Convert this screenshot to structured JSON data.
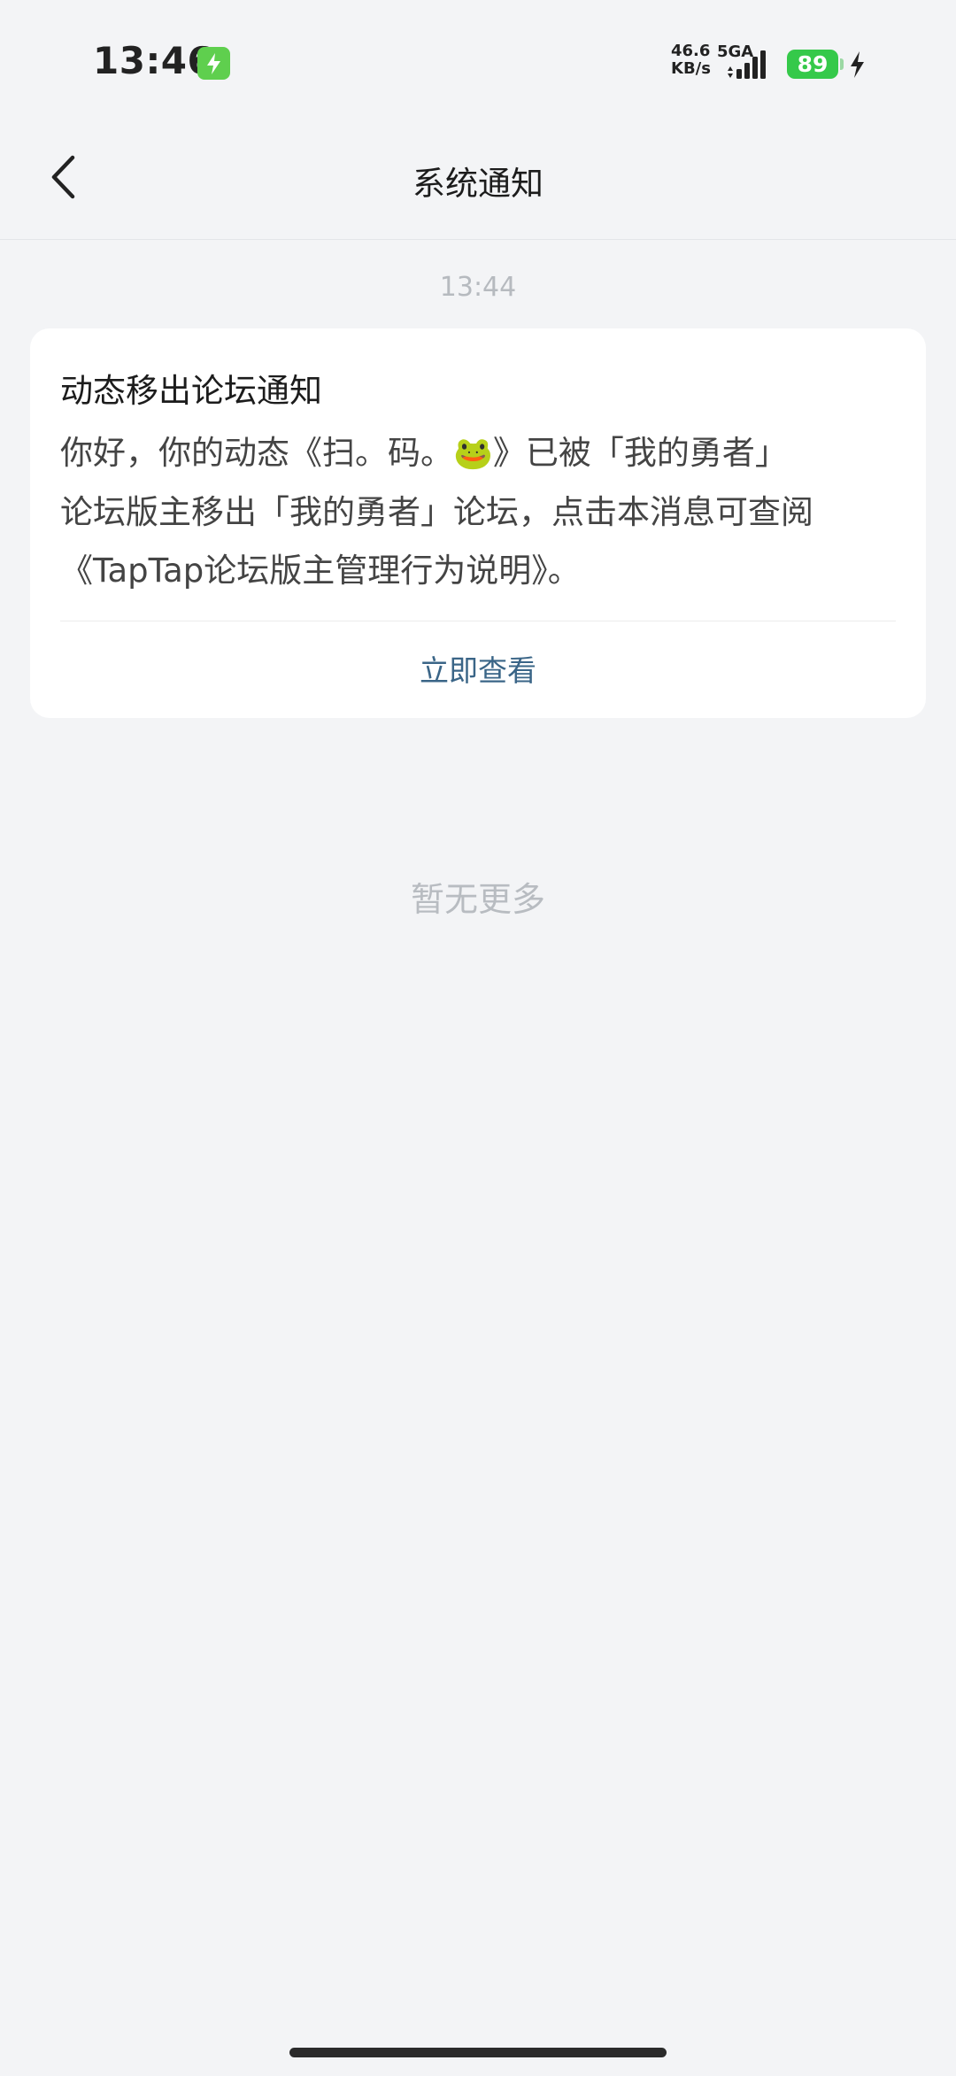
{
  "status_bar": {
    "time": "13:46",
    "net_speed_value": "46.6",
    "net_speed_unit": "KB/s",
    "network_type": "5GA",
    "battery_level": "89",
    "charging": true
  },
  "header": {
    "title": "系统通知",
    "back_icon": "chevron-left-icon"
  },
  "messages": [
    {
      "time": "13:44",
      "title": "动态移出论坛通知",
      "body_line1": "你好，你的动态《扫。码。",
      "emoji": "🐸",
      "body_line1_end": "》已被「我的勇者」",
      "body_line2": "论坛版主移出「我的勇者」论坛，点击本消息可查阅",
      "body_line3": "《TapTap论坛版主管理行为说明》。",
      "action_label": "立即查看"
    }
  ],
  "footer_text": "暂无更多",
  "colors": {
    "background": "#f3f4f6",
    "card": "#ffffff",
    "action": "#3a6587",
    "muted": "#b6babf",
    "battery": "#35c94a"
  }
}
